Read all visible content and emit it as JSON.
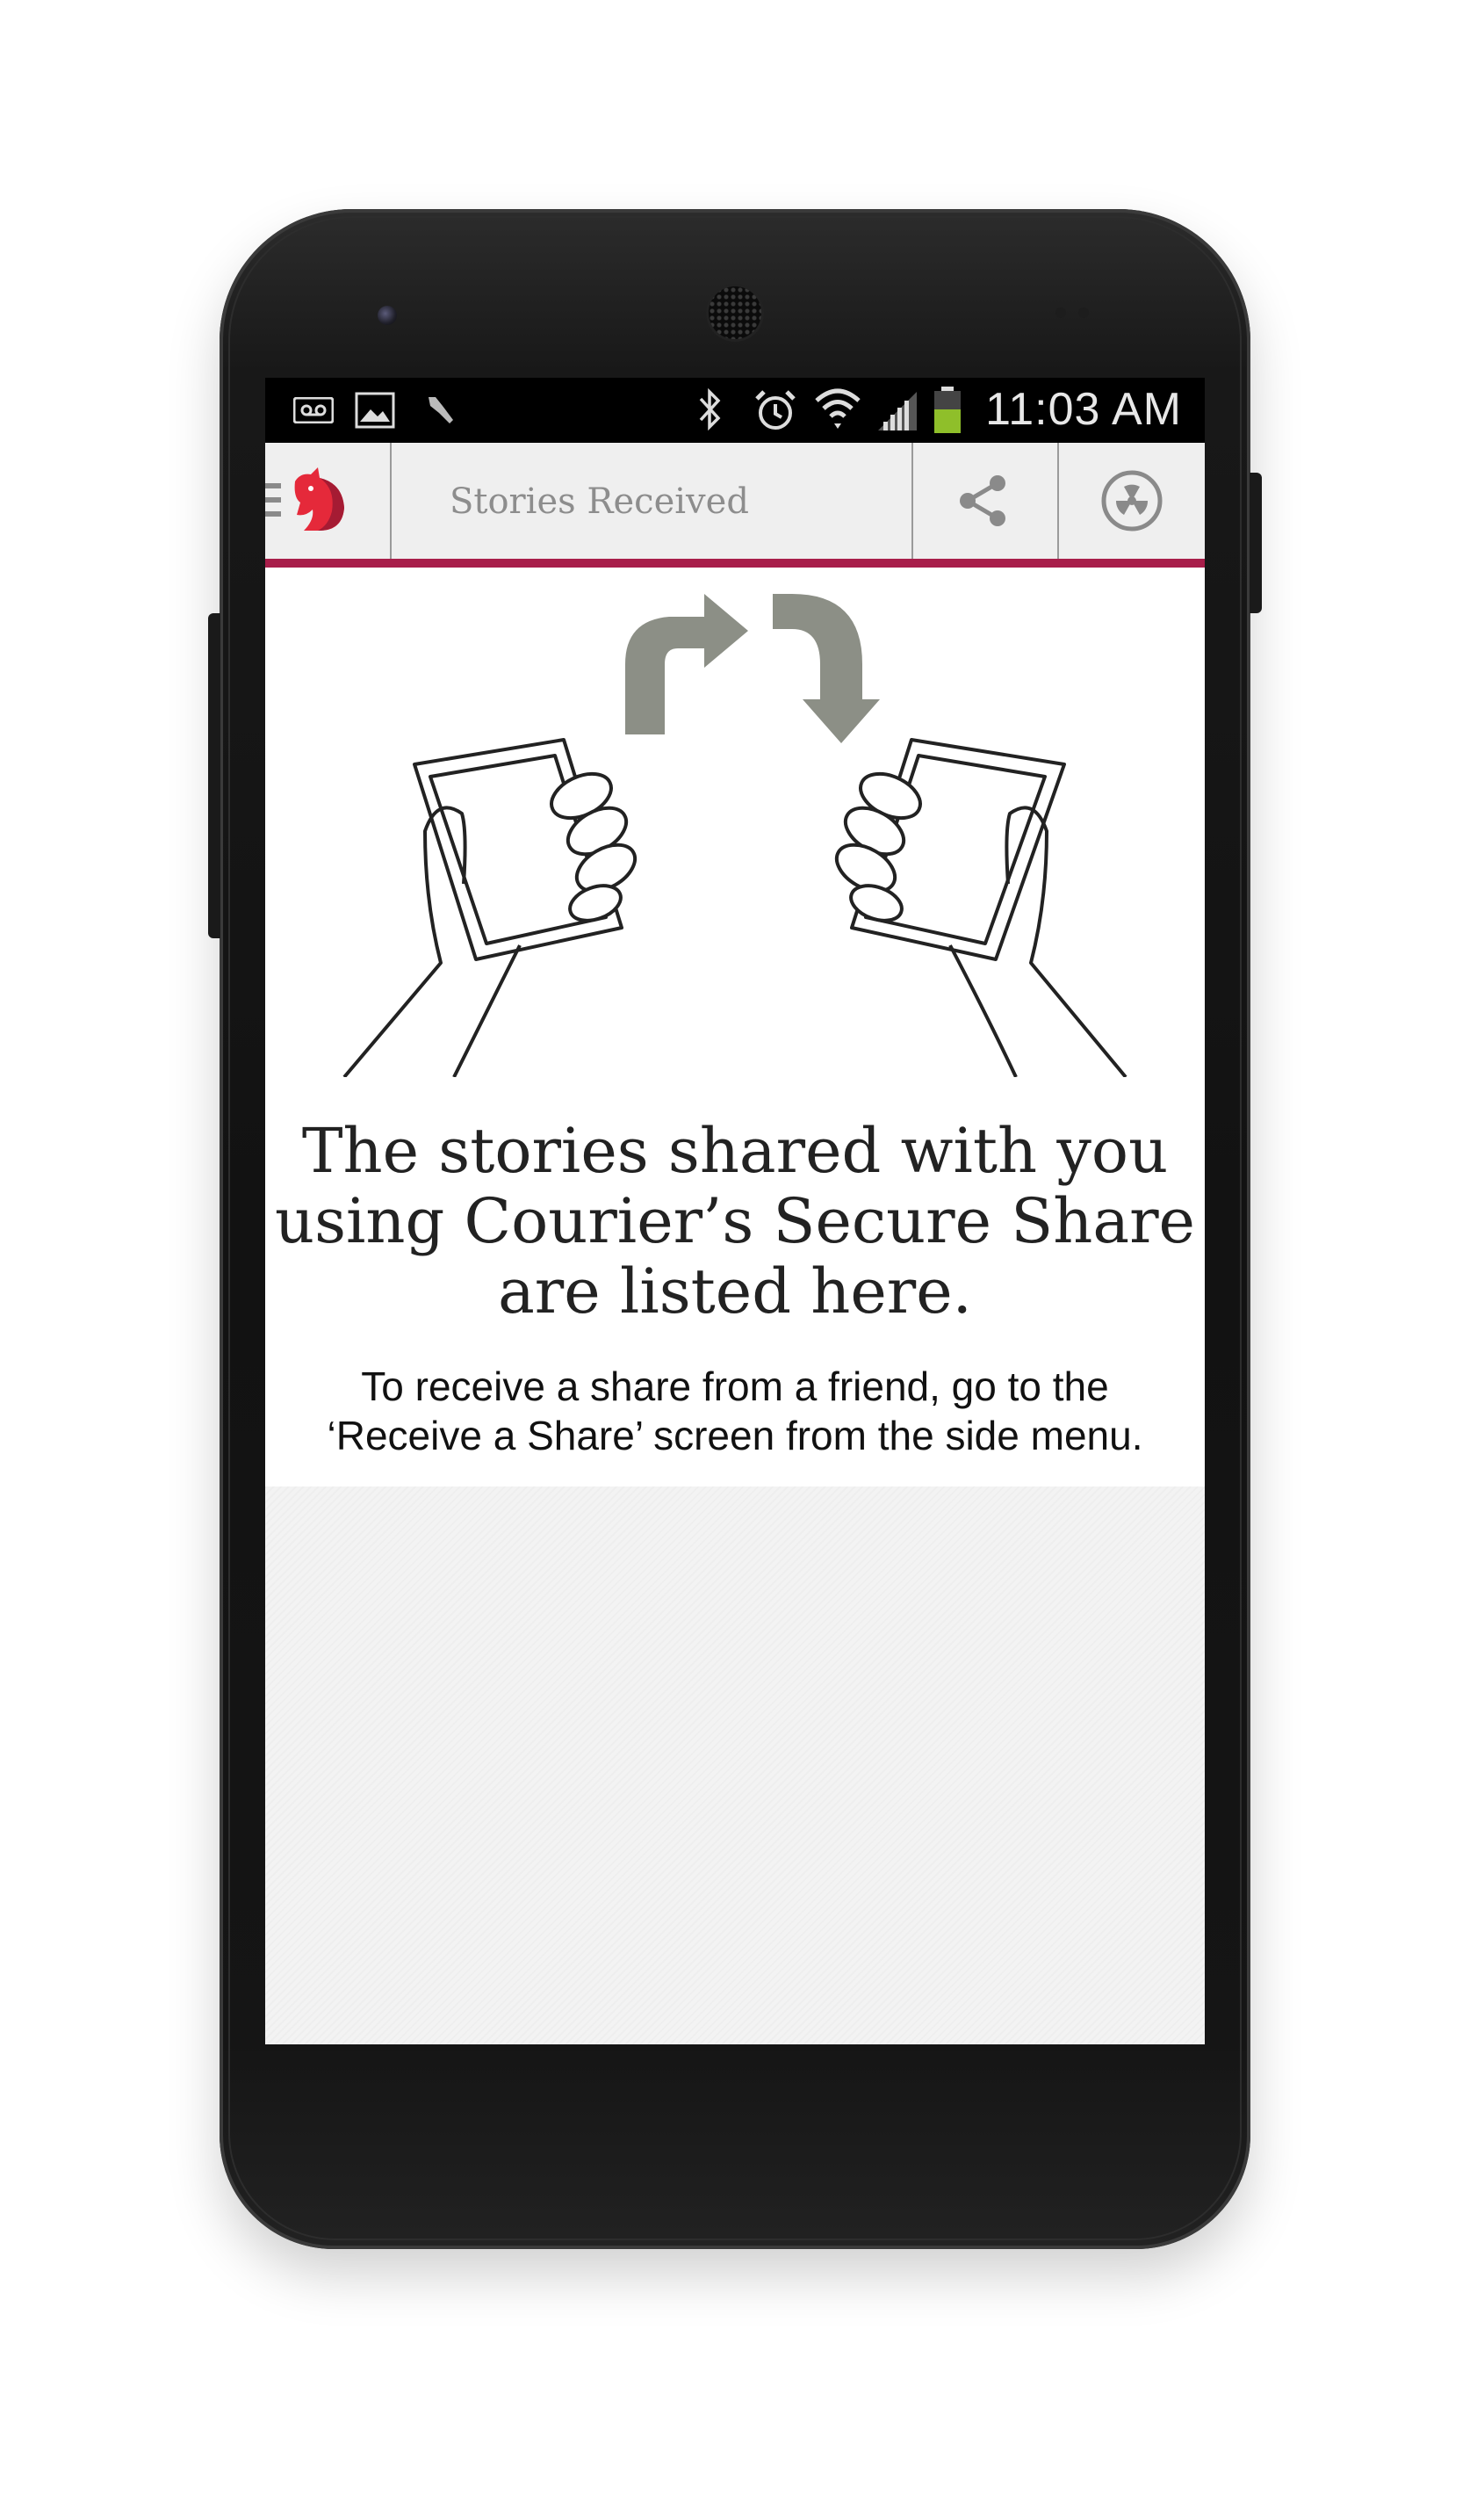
{
  "status_bar": {
    "time": "11:03 AM",
    "icons": [
      "voicemail-icon",
      "image-icon",
      "tool-icon",
      "bluetooth-icon",
      "alarm-icon",
      "wifi-icon",
      "signal-icon",
      "battery-icon"
    ]
  },
  "action_bar": {
    "title": "Stories Received",
    "menu_icon": "menu-icon",
    "app_icon": "courier-logo-icon",
    "share_icon": "share-icon",
    "radiation_icon": "radiation-icon"
  },
  "content": {
    "headline_line1": "The stories shared with you",
    "headline_line2": "using Courier’s Secure Share",
    "headline_line3": "are listed here.",
    "subtext_line1": "To receive a share from a friend, go to the",
    "subtext_line2": "‘Receive a Share’ screen from the side menu."
  },
  "colors": {
    "brand": "#a81e4a",
    "logo_red": "#e5293a",
    "action_bar_bg": "#efefef",
    "arrow_gray": "#8c8f86",
    "textured_bg": "#f3f3f3"
  }
}
